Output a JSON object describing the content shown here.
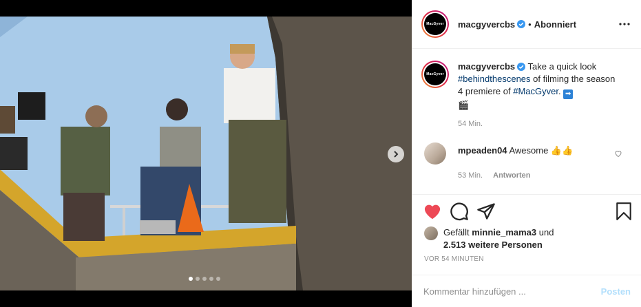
{
  "post": {
    "username": "macgyvercbs",
    "follow_sep": "•",
    "follow_status": "Abonniert",
    "logo_text": "MacGyver",
    "verified_icon": "verified-badge-icon",
    "more_icon": "more-horizontal-icon"
  },
  "caption": {
    "username": "macgyvercbs",
    "text_1": "Take a quick look",
    "hashtag_1": "#behindthescenes",
    "text_2": "of filming the season 4 premiere of",
    "hashtag_2": "#MacGyver",
    "text_3": ".",
    "arrow_emoji": "➡",
    "clapper_emoji": "🎬",
    "time": "54 Min."
  },
  "comment": {
    "username": "mpeaden04",
    "text": "Awesome",
    "emoji": "👍👍",
    "time": "53 Min.",
    "reply_label": "Antworten"
  },
  "media": {
    "page_count": 5,
    "active_page": 1
  },
  "likes": {
    "prefix": "Gefällt",
    "user": "minnie_mama3",
    "conj": "und",
    "others": "2.513 weitere Personen"
  },
  "timestamp": "VOR 54 MINUTEN",
  "add_comment": {
    "placeholder": "Kommentar hinzufügen ...",
    "post_label": "Posten"
  },
  "colors": {
    "heart": "#ed4956",
    "link": "#00376b",
    "post_disabled": "#b2dffc",
    "sky": "#a9cbe9"
  }
}
